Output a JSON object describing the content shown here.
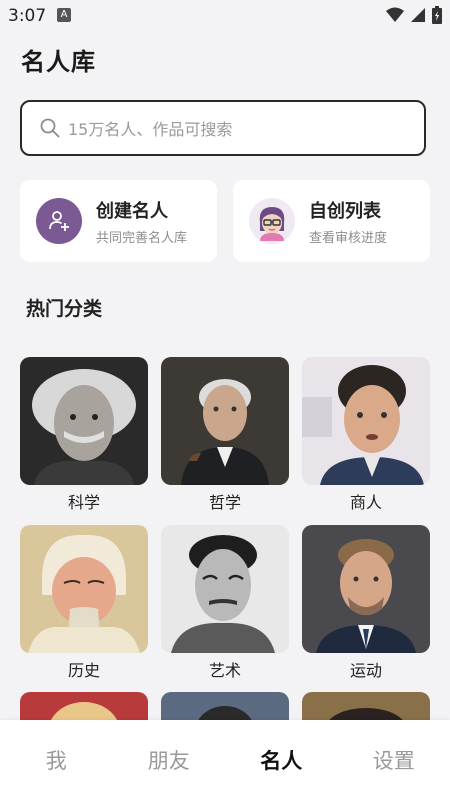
{
  "status": {
    "time": "3:07",
    "notification_icon": "A"
  },
  "header": {
    "title": "名人库"
  },
  "search": {
    "placeholder": "15万名人、作品可搜索"
  },
  "actions": [
    {
      "title": "创建名人",
      "subtitle": "共同完善名人库",
      "icon": "add-user-icon"
    },
    {
      "title": "自创列表",
      "subtitle": "查看审核进度",
      "icon": "avatar-icon"
    }
  ],
  "categories": {
    "title": "热门分类",
    "items": [
      {
        "label": "科学"
      },
      {
        "label": "哲学"
      },
      {
        "label": "商人"
      },
      {
        "label": "历史"
      },
      {
        "label": "艺术"
      },
      {
        "label": "运动"
      }
    ]
  },
  "nav": {
    "tabs": [
      "我",
      "朋友",
      "名人",
      "设置"
    ],
    "active": "名人"
  },
  "colors": {
    "accent": "#7b5a93",
    "background": "#f3f3f5",
    "inactive": "#9a9a9a"
  }
}
